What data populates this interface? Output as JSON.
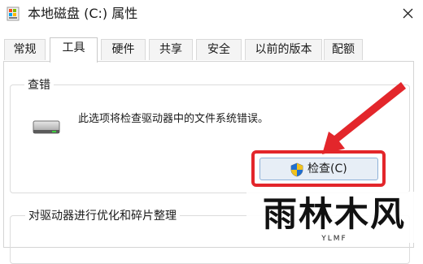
{
  "window": {
    "title": "本地磁盘 (C:) 属性",
    "title_icon": "drive-icon",
    "close_icon": "close-icon"
  },
  "tabs": [
    {
      "label": "常规",
      "active": false
    },
    {
      "label": "工具",
      "active": true
    },
    {
      "label": "硬件",
      "active": false
    },
    {
      "label": "共享",
      "active": false
    },
    {
      "label": "安全",
      "active": false
    },
    {
      "label": "以前的版本",
      "active": false
    },
    {
      "label": "配额",
      "active": false
    }
  ],
  "error_check": {
    "group_label": "查错",
    "description": "此选项将检查驱动器中的文件系统错误。",
    "button_label": "检查(C)",
    "button_icon": "uac-shield-icon"
  },
  "optimize": {
    "group_label": "对驱动器进行优化和碎片整理"
  },
  "annotation": {
    "highlight_color": "#e3262b",
    "arrow_color": "#e3262b"
  },
  "watermark": {
    "text": "雨林木风",
    "subtext": "YLMF"
  }
}
